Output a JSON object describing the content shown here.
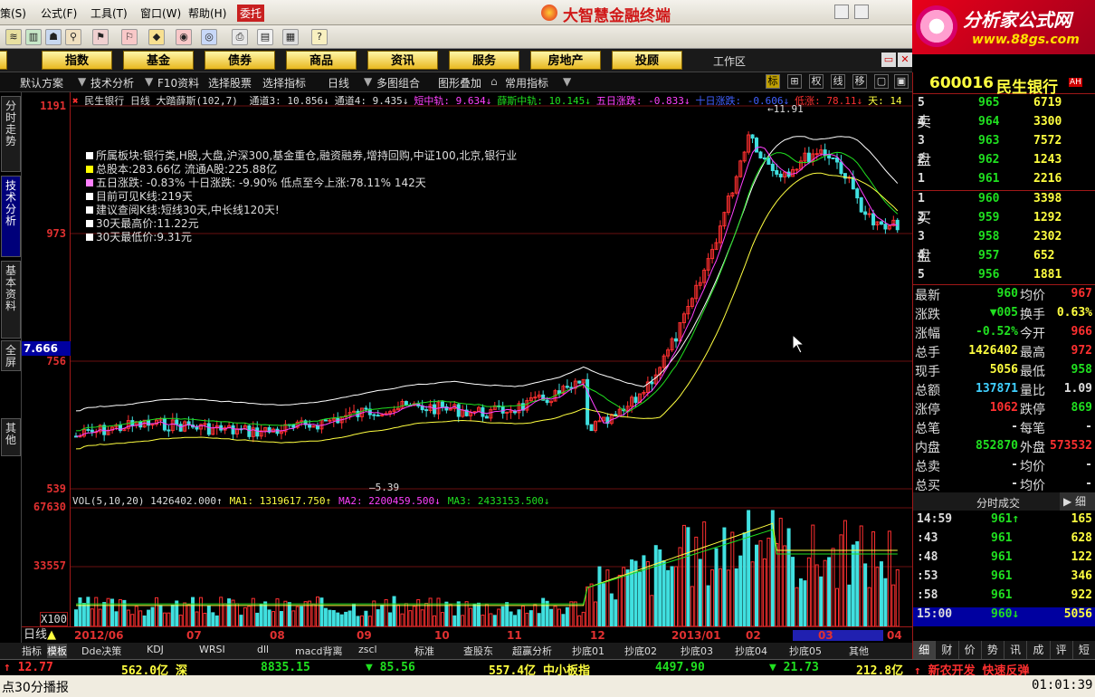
{
  "menu": {
    "items": [
      "策(S)",
      "公式(F)",
      "工具(T)",
      "窗口(W)",
      "帮助(H)"
    ],
    "trust": "委托",
    "app_title": "大智慧金融终端"
  },
  "promo": {
    "title": "分析家公式网",
    "url": "www.88gs.com"
  },
  "categories": [
    "股",
    "指数",
    "基金",
    "债券",
    "商品",
    "资讯",
    "服务",
    "房地产",
    "投顾"
  ],
  "workarea": "工作区",
  "toolbar2": {
    "items": [
      "默认方案",
      "技术分析",
      "F10资料",
      "选择股票",
      "选择指标",
      "日线",
      "多图组合",
      "图形叠加",
      "常用指标"
    ],
    "right_buttons": [
      "标",
      "⊞",
      "权",
      "线",
      "移",
      "▢",
      "▣"
    ]
  },
  "side_tabs": [
    "分时走势",
    "技术分析",
    "基本资料",
    "全屏",
    "其他"
  ],
  "price_axis": {
    "labels": [
      "1191",
      "973",
      "756",
      "539"
    ],
    "current": "7.666"
  },
  "volume_axis": {
    "labels": [
      "67630",
      "33557"
    ],
    "unit": "X100"
  },
  "legend": {
    "stock": "民生银行",
    "period": "日线",
    "indicator": "大踏薛斯(102,7)",
    "items": [
      {
        "text": "通道3: 10.856↓",
        "color": "#dddddd"
      },
      {
        "text": "通道4: 9.435↓",
        "color": "#dddddd"
      },
      {
        "text": "短中轨: 9.634↓",
        "color": "#ff40ff"
      },
      {
        "text": "薛斯中轨: 10.145↓",
        "color": "#20e020"
      },
      {
        "text": "五日涨跌: -0.833↓",
        "color": "#ff40ff"
      },
      {
        "text": "十日涨跌: -0.606↓",
        "color": "#4060ff"
      },
      {
        "text": "低涨: 78.11↓",
        "color": "#ff3030"
      },
      {
        "text": "天: 14",
        "color": "#ffff40"
      }
    ]
  },
  "info": [
    {
      "text": "所属板块:银行类,H股,大盘,沪深300,基金重仓,融资融券,增持回购,中证100,北京,银行业",
      "color": "#ffffff"
    },
    {
      "text": "总股本:283.66亿  流通A股:225.88亿",
      "color": "#ffff00"
    },
    {
      "text": "五日涨跌: -0.83%    十日涨跌: -9.90%  低点至今上涨:78.11%   142天",
      "color": "#ff80ff"
    },
    {
      "text": "目前可见K线:219天",
      "color": "#ffffff"
    },
    {
      "text": "建议查阅K线:短线30天,中长线120天!",
      "color": "#ffffff"
    },
    {
      "text": "30天最高价:11.22元",
      "color": "#ffffff"
    },
    {
      "text": "30天最低价:9.31元",
      "color": "#ffffff"
    }
  ],
  "chart_annotations": {
    "high": "11.91",
    "low": "5.39"
  },
  "volume_legend": {
    "items": [
      {
        "text": "VOL(5,10,20) 1426402.000↑",
        "color": "#dddddd"
      },
      {
        "text": "MA1: 1319617.750↑",
        "color": "#ffff40"
      },
      {
        "text": "MA2: 2200459.500↓",
        "color": "#ff40ff"
      },
      {
        "text": "MA3: 2433153.500↓",
        "color": "#20e020"
      }
    ]
  },
  "x_axis": {
    "period_label": "日线",
    "labels": [
      "2012/06",
      "07",
      "08",
      "09",
      "10",
      "11",
      "12",
      "2013/01",
      "02",
      "03",
      "04"
    ]
  },
  "indicator_tabs": [
    "指标",
    "模板",
    "Dde决策",
    "KDJ",
    "WRSI",
    "dll",
    "macd背离",
    "zscl",
    "标准",
    "查股东",
    "超赢分析",
    "抄底01",
    "抄底02",
    "抄底03",
    "抄底04",
    "抄底05",
    "其他"
  ],
  "quote": {
    "code": "600016",
    "name": "民生银行",
    "ah_badge": "AH",
    "sell": [
      {
        "lvl": "5",
        "p": "965",
        "v": "6719"
      },
      {
        "lvl": "4",
        "p": "964",
        "v": "3300"
      },
      {
        "lvl": "3",
        "p": "963",
        "v": "7572"
      },
      {
        "lvl": "2",
        "p": "962",
        "v": "1243"
      },
      {
        "lvl": "1",
        "p": "961",
        "v": "2216"
      }
    ],
    "buy": [
      {
        "lvl": "1",
        "p": "960",
        "v": "3398"
      },
      {
        "lvl": "2",
        "p": "959",
        "v": "1292"
      },
      {
        "lvl": "3",
        "p": "958",
        "v": "2302"
      },
      {
        "lvl": "4",
        "p": "957",
        "v": "652"
      },
      {
        "lvl": "5",
        "p": "956",
        "v": "1881"
      }
    ],
    "sell_label": [
      "卖",
      "盘"
    ],
    "buy_label": [
      "买",
      "盘"
    ],
    "stats": [
      {
        "k1": "最新",
        "v1": "960",
        "c1": "#20e020",
        "k2": "均价",
        "v2": "967",
        "c2": "#ff3030"
      },
      {
        "k1": "涨跌",
        "v1": "▼005",
        "c1": "#20e020",
        "k2": "换手",
        "v2": "0.63%",
        "c2": "#ffff40"
      },
      {
        "k1": "涨幅",
        "v1": "-0.52%",
        "c1": "#20e020",
        "k2": "今开",
        "v2": "966",
        "c2": "#ff3030"
      },
      {
        "k1": "总手",
        "v1": "1426402",
        "c1": "#ffff40",
        "k2": "最高",
        "v2": "972",
        "c2": "#ff3030"
      },
      {
        "k1": "现手",
        "v1": "5056",
        "c1": "#ffff40",
        "k2": "最低",
        "v2": "958",
        "c2": "#20e020"
      },
      {
        "k1": "总额",
        "v1": "137871",
        "c1": "#40d0ff",
        "k2": "量比",
        "v2": "1.09",
        "c2": "#dddddd"
      },
      {
        "k1": "涨停",
        "v1": "1062",
        "c1": "#ff3030",
        "k2": "跌停",
        "v2": "869",
        "c2": "#20e020"
      },
      {
        "k1": "总笔",
        "v1": "-",
        "c1": "#dddddd",
        "k2": "每笔",
        "v2": "-",
        "c2": "#dddddd"
      },
      {
        "k1": "内盘",
        "v1": "852870",
        "c1": "#20e020",
        "k2": "外盘",
        "v2": "573532",
        "c2": "#ff3030"
      },
      {
        "k1": "总卖",
        "v1": "-",
        "c1": "#dddddd",
        "k2": "均价",
        "v2": "-",
        "c2": "#dddddd"
      },
      {
        "k1": "总买",
        "v1": "-",
        "c1": "#dddddd",
        "k2": "均价",
        "v2": "-",
        "c2": "#dddddd"
      }
    ],
    "trades_title": "分时成交",
    "trades_btn": "细",
    "trades": [
      {
        "t": "14:59",
        "p": "961↑",
        "v": "165"
      },
      {
        "t": ":43",
        "p": "961",
        "v": "628"
      },
      {
        "t": ":48",
        "p": "961",
        "v": "122"
      },
      {
        "t": ":53",
        "p": "961",
        "v": "346"
      },
      {
        "t": ":58",
        "p": "961",
        "v": "922"
      },
      {
        "t": "15:00",
        "p": "960↓",
        "v": "5056"
      }
    ],
    "tabs": [
      "细",
      "财",
      "价",
      "势",
      "讯",
      "成",
      "评",
      "短"
    ]
  },
  "status": {
    "items": [
      {
        "text": "↑ 12.77",
        "color": "#ff3030"
      },
      {
        "text": "562.0亿 深",
        "color": "#ffff40"
      },
      {
        "text": "8835.15",
        "color": "#20e020"
      },
      {
        "text": "▼ 85.56",
        "color": "#20e020"
      },
      {
        "text": "557.4亿 中小板指",
        "color": "#ffff40"
      },
      {
        "text": "4497.90",
        "color": "#20e020"
      },
      {
        "text": "▼ 21.73",
        "color": "#20e020"
      },
      {
        "text": "212.8亿",
        "color": "#ffff40"
      },
      {
        "text": "↑ 新农开发 快速反弹",
        "color": "#ff3030"
      }
    ]
  },
  "status2": {
    "left": "点30分播报",
    "time": "01:01:39"
  },
  "colors": {
    "up": "#ff3030",
    "down": "#40e0e0",
    "grid": "#a01818",
    "ma_white": "#ffffff",
    "ma_green": "#20e020",
    "ma_yellow": "#ffff40",
    "ma_magenta": "#ff40ff"
  }
}
